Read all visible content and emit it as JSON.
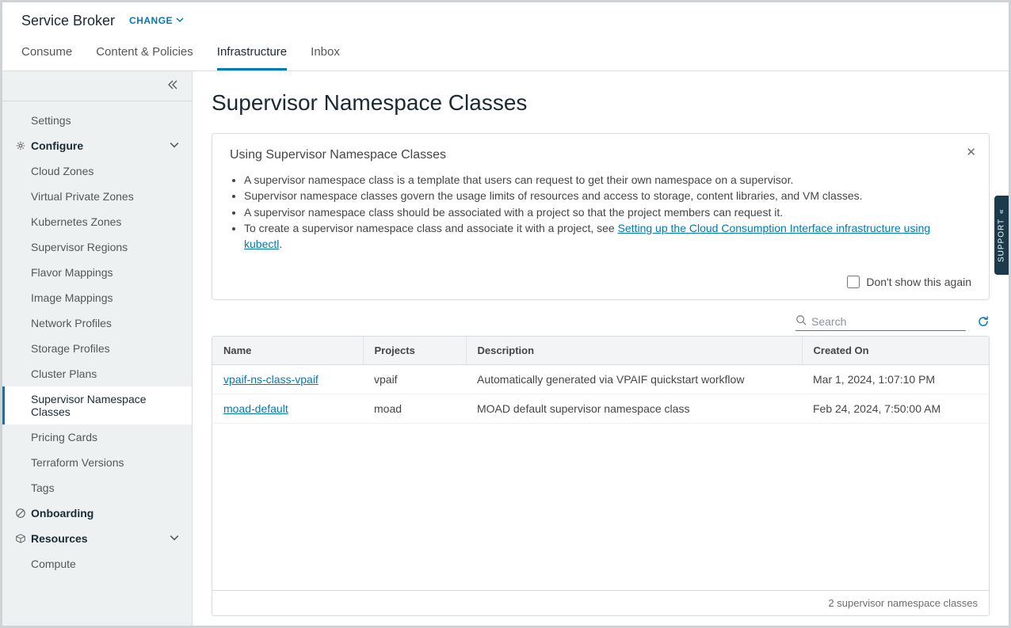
{
  "header": {
    "app_title": "Service Broker",
    "change_label": "CHANGE"
  },
  "tabs": [
    {
      "id": "consume",
      "label": "Consume",
      "active": false
    },
    {
      "id": "content-policies",
      "label": "Content & Policies",
      "active": false
    },
    {
      "id": "infrastructure",
      "label": "Infrastructure",
      "active": true
    },
    {
      "id": "inbox",
      "label": "Inbox",
      "active": false
    }
  ],
  "sidebar": {
    "top": [
      {
        "label": "Settings",
        "active": false
      }
    ],
    "configure": {
      "label": "Configure",
      "items": [
        {
          "label": "Cloud Zones",
          "active": false
        },
        {
          "label": "Virtual Private Zones",
          "active": false
        },
        {
          "label": "Kubernetes Zones",
          "active": false
        },
        {
          "label": "Supervisor Regions",
          "active": false
        },
        {
          "label": "Flavor Mappings",
          "active": false
        },
        {
          "label": "Image Mappings",
          "active": false
        },
        {
          "label": "Network Profiles",
          "active": false
        },
        {
          "label": "Storage Profiles",
          "active": false
        },
        {
          "label": "Cluster Plans",
          "active": false
        },
        {
          "label": "Supervisor Namespace Classes",
          "active": true
        },
        {
          "label": "Pricing Cards",
          "active": false
        },
        {
          "label": "Terraform Versions",
          "active": false
        },
        {
          "label": "Tags",
          "active": false
        }
      ]
    },
    "onboarding": {
      "label": "Onboarding"
    },
    "resources": {
      "label": "Resources",
      "items": [
        {
          "label": "Compute",
          "active": false
        }
      ]
    }
  },
  "page": {
    "title": "Supervisor Namespace Classes",
    "card": {
      "title": "Using Supervisor Namespace Classes",
      "bullets": [
        "A supervisor namespace class is a template that users can request to get their own namespace on a supervisor.",
        "Supervisor namespace classes govern the usage limits of resources and access to storage, content libraries, and VM classes.",
        "A supervisor namespace class should be associated with a project so that the project members can request it."
      ],
      "bullet4_prefix": "To create a supervisor namespace class and associate it with a project, see ",
      "bullet4_link": "Setting up the Cloud Consumption Interface infrastructure using kubectl",
      "bullet4_suffix": ".",
      "dont_show": "Don't show this again"
    },
    "search_placeholder": "Search",
    "table": {
      "columns": [
        "Name",
        "Projects",
        "Description",
        "Created On"
      ],
      "rows": [
        {
          "name": "vpaif-ns-class-vpaif",
          "projects": "vpaif",
          "description": "Automatically generated via VPAIF quickstart workflow",
          "created": "Mar 1, 2024, 1:07:10 PM"
        },
        {
          "name": "moad-default",
          "projects": "moad",
          "description": "MOAD default supervisor namespace class",
          "created": "Feb 24, 2024, 7:50:00 AM"
        }
      ],
      "footer": "2 supervisor namespace classes"
    }
  },
  "support_label": "SUPPORT"
}
